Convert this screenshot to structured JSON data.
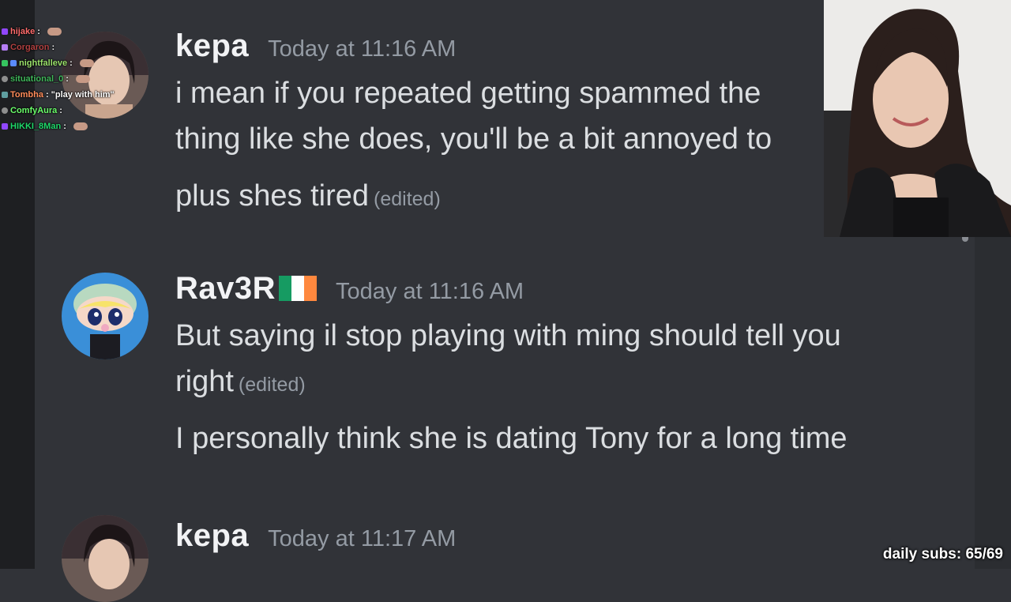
{
  "messages": [
    {
      "author": "kepa",
      "timestamp": "Today at 11:16 AM",
      "lines": [
        "i mean if you repeated getting spammed the",
        "thing like she does, you'll be a bit annoyed to",
        "plus shes tired"
      ],
      "edited": "(edited)"
    },
    {
      "author": "Rav3R",
      "timestamp": "Today at 11:16 AM",
      "lines": [
        "But saying il stop playing with ming should  tell you",
        "right",
        "I personally think she is dating Tony for a long time"
      ],
      "edited": "(edited)"
    },
    {
      "author": "kepa",
      "timestamp": "Today at 11:17 AM"
    }
  ],
  "stream_chat": [
    {
      "user": "hijake",
      "sep": ":",
      "text": "",
      "color": "#ff6b6b"
    },
    {
      "user": "Corgaron",
      "sep": ":",
      "text": "",
      "color": "#b04040"
    },
    {
      "user": "nightfalleve",
      "sep": ":",
      "text": "",
      "color": "#9be26b"
    },
    {
      "user": "situational_0",
      "sep": ":",
      "text": "",
      "color": "#3fb65a"
    },
    {
      "user": "Tombha",
      "sep": ":",
      "text": "\"play with him\"",
      "color": "#ff8c5a"
    },
    {
      "user": "ComfyAura",
      "sep": ":",
      "text": "",
      "color": "#6bff6b"
    },
    {
      "user": "HIKKI_8Man",
      "sep": ":",
      "text": "",
      "color": "#1fd86a"
    }
  ],
  "overlay": {
    "daily_subs": "daily subs: 65/69"
  }
}
